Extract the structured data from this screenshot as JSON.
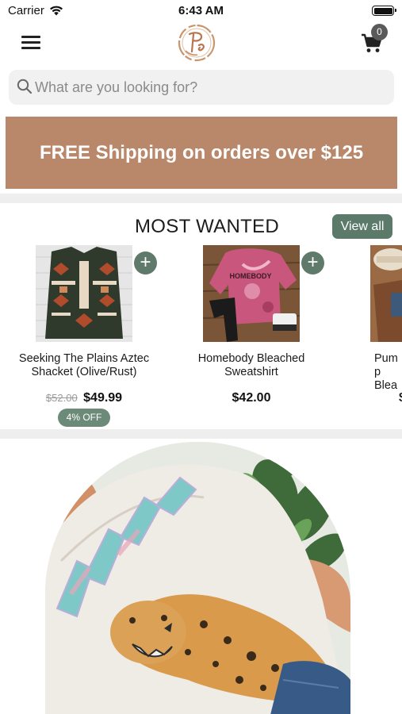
{
  "status_bar": {
    "carrier": "Carrier",
    "time": "6:43 AM"
  },
  "header": {
    "cart_count": "0"
  },
  "search": {
    "placeholder": "What are you looking for?"
  },
  "promo": {
    "text": "FREE Shipping on orders over $125"
  },
  "most_wanted": {
    "title": "MOST WANTED",
    "view_all_label": "View all",
    "products": [
      {
        "name": "Seeking The Plains Aztec Shacket (Olive/Rust)",
        "old_price": "$52.00",
        "price": "$49.99",
        "discount": "4% OFF"
      },
      {
        "name": "Homebody Bleached Sweatshirt",
        "price": "$42.00"
      },
      {
        "name": "Pump Blea",
        "price": "$"
      }
    ]
  },
  "colors": {
    "banner": "#b9876a",
    "accent_green": "#5b7a6a",
    "divider": "#eeeeee"
  },
  "icons": [
    "wifi-icon",
    "battery-icon",
    "menu-icon",
    "logo",
    "cart-icon",
    "search-icon",
    "plus-icon"
  ]
}
